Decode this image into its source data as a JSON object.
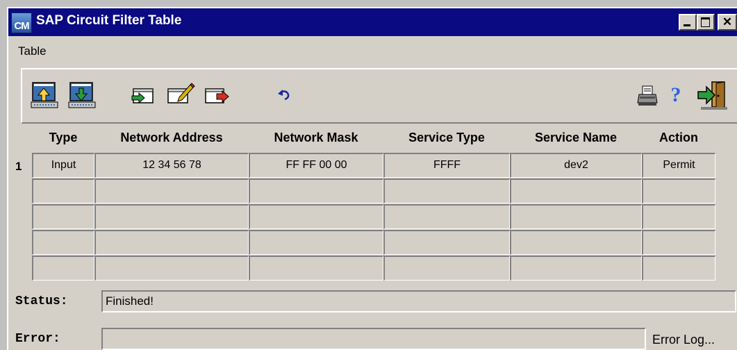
{
  "window": {
    "icon_text": "CM",
    "title": "SAP Circuit Filter Table",
    "close_glyph": "✕"
  },
  "menu": {
    "items": [
      "Table"
    ]
  },
  "toolbar": {
    "buttons": [
      {
        "name": "upload-icon",
        "color": "#3a6fb0"
      },
      {
        "name": "download-icon",
        "color": "#2a9a3a"
      },
      {
        "name": "insert-row-icon",
        "color": "#2a9a3a"
      },
      {
        "name": "edit-row-icon",
        "color": "#d8b400"
      },
      {
        "name": "delete-row-icon",
        "color": "#d03020"
      },
      {
        "name": "undo-icon",
        "color": "#1a2a9a"
      },
      {
        "name": "print-icon",
        "color": "#404040"
      },
      {
        "name": "help-icon",
        "color": "#3060e0"
      },
      {
        "name": "exit-icon",
        "color": "#2a9a3a"
      }
    ],
    "help_glyph": "?"
  },
  "table": {
    "columns": [
      "Type",
      "Network Address",
      "Network Mask",
      "Service Type",
      "Service Name",
      "Action"
    ],
    "row_number": "1",
    "rows": [
      [
        "Input",
        "12 34 56 78",
        "FF FF 00 00",
        "FFFF",
        "dev2",
        "Permit"
      ],
      [
        "",
        "",
        "",
        "",
        "",
        ""
      ],
      [
        "",
        "",
        "",
        "",
        "",
        ""
      ],
      [
        "",
        "",
        "",
        "",
        "",
        ""
      ],
      [
        "",
        "",
        "",
        "",
        "",
        ""
      ]
    ]
  },
  "status": {
    "label": "Status:",
    "value": "Finished!"
  },
  "error": {
    "label": "Error:",
    "value": "",
    "log_button": "Error Log..."
  },
  "colors": {
    "titlebar": "#0a0a82",
    "face": "#d4d0c8"
  }
}
